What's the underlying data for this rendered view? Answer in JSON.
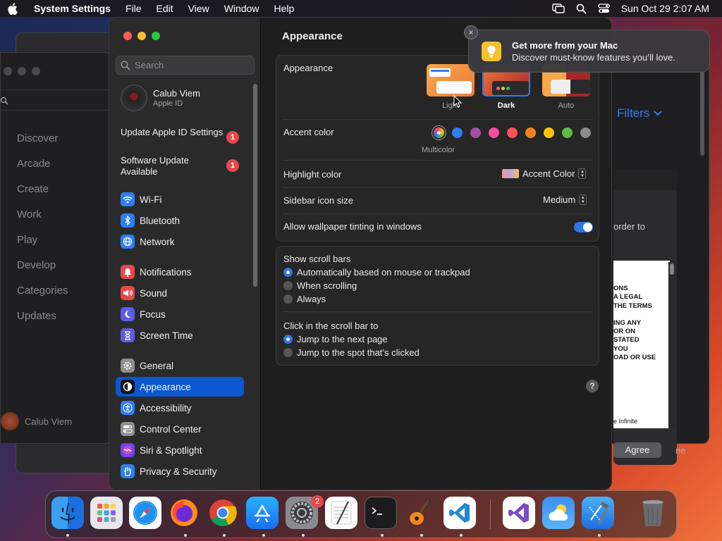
{
  "menubar": {
    "app": "System Settings",
    "menus": [
      "File",
      "Edit",
      "View",
      "Window",
      "Help"
    ],
    "datetime": "Sun Oct 29  2:07 AM"
  },
  "background": {
    "nav": [
      "Discover",
      "Arcade",
      "Create",
      "Work",
      "Play",
      "Develop",
      "Categories",
      "Updates"
    ],
    "user": "Calub Viem",
    "filters": "Filters",
    "order_text": "order to",
    "license_lines": [
      "ONS",
      "A LEGAL",
      "THE TERMS",
      "",
      "ING ANY",
      "OR ON",
      "STATED",
      "YOU",
      "OAD OR USE"
    ],
    "license_footer": "e Infinite",
    "agree": "Agree",
    "ne": "ne"
  },
  "sidebar": {
    "search_placeholder": "Search",
    "profile": {
      "name": "Calub Viem",
      "sub": "Apple ID"
    },
    "updates": [
      {
        "label": "Update Apple ID Settings",
        "badge": "1"
      },
      {
        "label": "Software Update Available",
        "badge": "1"
      }
    ],
    "items": [
      {
        "label": "Wi-Fi",
        "icon": "wifi-icon",
        "color": "#2f7ff0"
      },
      {
        "label": "Bluetooth",
        "icon": "bluetooth-icon",
        "color": "#2f7ff0"
      },
      {
        "label": "Network",
        "icon": "globe-icon",
        "color": "#2f7ff0"
      },
      {
        "label": "Notifications",
        "icon": "bell-icon",
        "color": "#e5484d"
      },
      {
        "label": "Sound",
        "icon": "speaker-icon",
        "color": "#e5484d"
      },
      {
        "label": "Focus",
        "icon": "moon-icon",
        "color": "#5e5ce6"
      },
      {
        "label": "Screen Time",
        "icon": "hourglass-icon",
        "color": "#5e5ce6"
      },
      {
        "label": "General",
        "icon": "gear-icon",
        "color": "#8e8e93"
      },
      {
        "label": "Appearance",
        "icon": "appearance-icon",
        "color": "#111111"
      },
      {
        "label": "Accessibility",
        "icon": "accessibility-icon",
        "color": "#2f7ff0"
      },
      {
        "label": "Control Center",
        "icon": "toggles-icon",
        "color": "#8e8e93"
      },
      {
        "label": "Siri & Spotlight",
        "icon": "siri-icon",
        "color": "#b44fd8"
      },
      {
        "label": "Privacy & Security",
        "icon": "hand-icon",
        "color": "#2f7ff0"
      }
    ]
  },
  "content": {
    "title": "Appearance",
    "appearance_label": "Appearance",
    "modes": [
      "Light",
      "Dark",
      "Auto"
    ],
    "selected_mode": "Dark",
    "accent_label": "Accent color",
    "accent_colors": [
      "multicolor",
      "#2f7ff0",
      "#a550a7",
      "#f74f9e",
      "#ff5257",
      "#f7821b",
      "#ffc600",
      "#62ba46",
      "#8c8c8c"
    ],
    "accent_selected_name": "Multicolor",
    "highlight_label": "Highlight color",
    "highlight_value": "Accent Color",
    "sidebar_icon_label": "Sidebar icon size",
    "sidebar_icon_value": "Medium",
    "tinting_label": "Allow wallpaper tinting in windows",
    "tinting_on": true,
    "scroll_title": "Show scroll bars",
    "scroll_options": [
      "Automatically based on mouse or trackpad",
      "When scrolling",
      "Always"
    ],
    "click_title": "Click in the scroll bar to",
    "click_options": [
      "Jump to the next page",
      "Jump to the spot that’s clicked"
    ],
    "help": "?"
  },
  "notification": {
    "title": "Get more from your Mac",
    "body": "Discover must-know features you’ll love.",
    "close": "×"
  },
  "dock": {
    "apps": [
      "Finder",
      "Launchpad",
      "Safari",
      "Firefox",
      "Chrome",
      "App Store",
      "System Settings",
      "TextEdit",
      "Terminal",
      "GarageBand",
      "Visual Studio Code",
      "Visual Studio",
      "Weather",
      "Xcode",
      "Trash"
    ],
    "settings_badge": "2"
  }
}
